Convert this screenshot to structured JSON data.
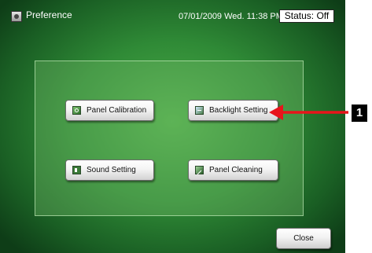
{
  "window": {
    "title": "Preference",
    "datetime": "07/01/2009 Wed. 11:38 PM",
    "status": "Status: Off"
  },
  "buttons": {
    "panel_calibration": "Panel Calibration",
    "backlight_setting": "Backlight Setting",
    "sound_setting": "Sound Setting",
    "panel_cleaning": "Panel Cleaning",
    "close": "Close"
  },
  "callout": {
    "number": "1",
    "arrow_color": "#e8141b"
  },
  "icons": {
    "title": "preference-icon",
    "panel_calibration": "calibration-icon",
    "backlight_setting": "backlight-icon",
    "sound_setting": "speaker-icon",
    "panel_cleaning": "cleaning-icon"
  }
}
